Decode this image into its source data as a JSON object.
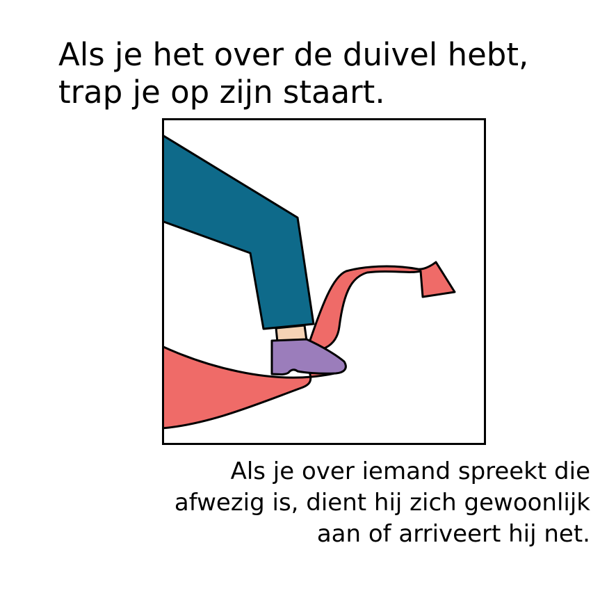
{
  "idiom": {
    "lines": [
      "Als je het over de duivel hebt,",
      "trap je op zijn staart."
    ]
  },
  "meaning": {
    "lines": [
      "Als je over iemand spreekt die",
      "afwezig is, dient hij zich gewoonlijk",
      "aan of arriveert hij net."
    ]
  },
  "illustration": {
    "subject": "foot stepping on devil tail",
    "colors": {
      "trousers": "#0e6a8a",
      "skin": "#f5d3b5",
      "shoe": "#9b7dbb",
      "tail": "#ef6b68",
      "outline": "#000000",
      "background": "#ffffff"
    }
  }
}
